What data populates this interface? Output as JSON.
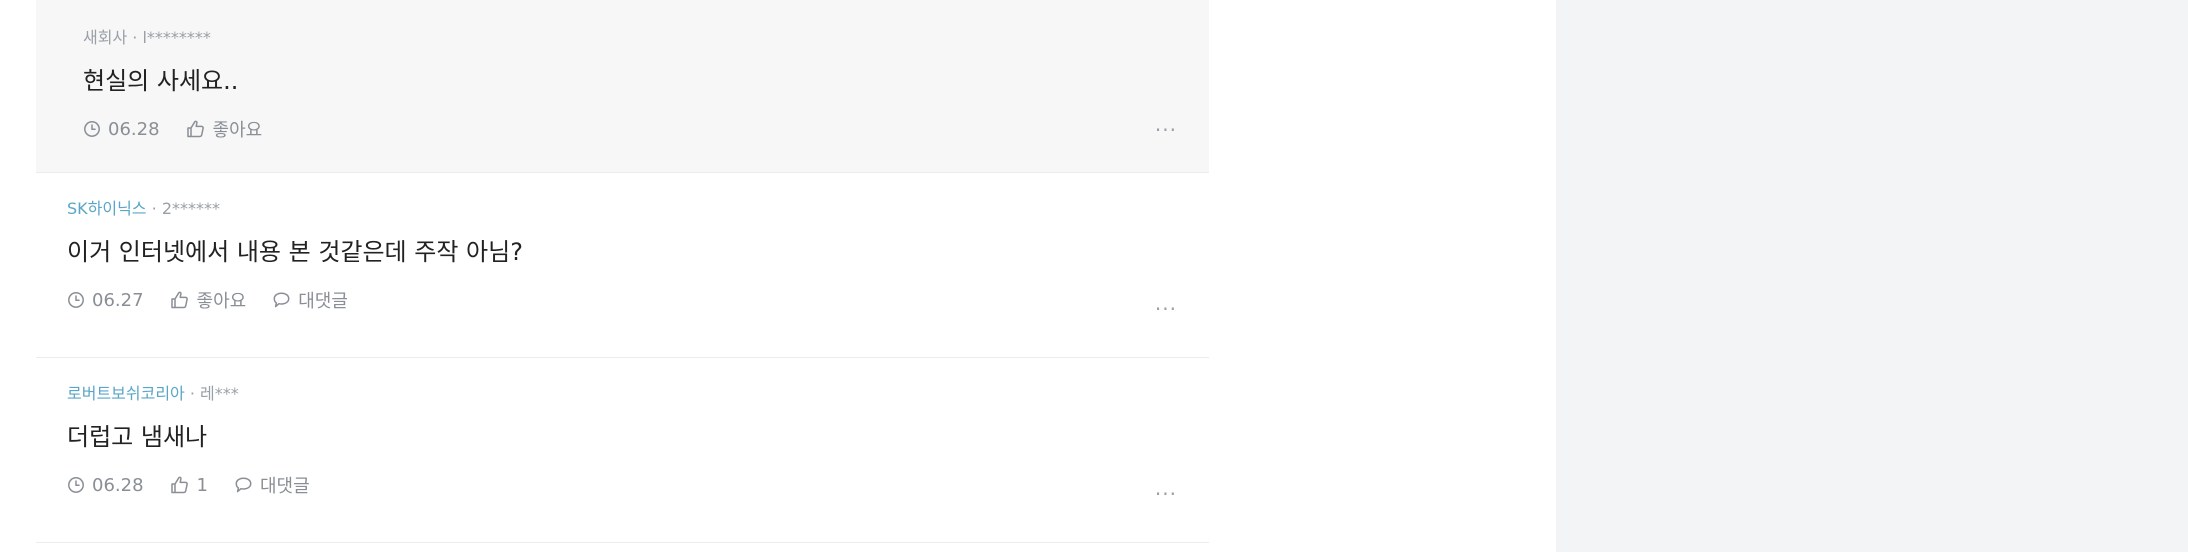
{
  "comments": [
    {
      "kind": "reply",
      "company": "새회사",
      "author": "l********",
      "text": "현실의 사세요..",
      "date": "06.28",
      "like_label": "좋아요",
      "more": "···"
    },
    {
      "kind": "top",
      "company": "SK하이닉스",
      "author": "2******",
      "text": "이거 인터넷에서 내용 본 것같은데 주작 아님?",
      "date": "06.27",
      "like_label": "좋아요",
      "reply_label": "대댓글",
      "more": "···"
    },
    {
      "kind": "top",
      "company": "로버트보쉬코리아",
      "author": "레***",
      "text": "더럽고 냄새나",
      "date": "06.28",
      "like_label": "1",
      "reply_label": "대댓글",
      "more": "···"
    }
  ],
  "separator": "·"
}
